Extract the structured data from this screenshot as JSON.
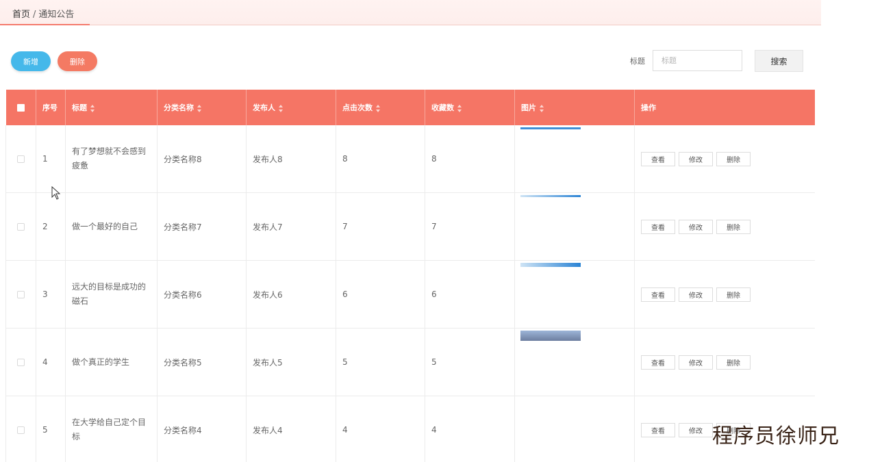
{
  "breadcrumb": {
    "home": "首页",
    "separator": "/",
    "current": "通知公告"
  },
  "toolbar": {
    "add_label": "新增",
    "delete_label": "删除"
  },
  "search": {
    "label": "标题",
    "placeholder": "标题",
    "value": "",
    "button_label": "搜索"
  },
  "table": {
    "columns": [
      "序号",
      "标题",
      "分类名称",
      "发布人",
      "点击次数",
      "收藏数",
      "图片",
      "操作"
    ],
    "rows": [
      {
        "index": "1",
        "title": "有了梦想就不会感到疲惫",
        "category": "分类名称8",
        "publisher": "发布人8",
        "clicks": "8",
        "favorites": "8",
        "image": "sky-banner"
      },
      {
        "index": "2",
        "title": "做一个最好的自己",
        "category": "分类名称7",
        "publisher": "发布人7",
        "clicks": "7",
        "favorites": "7",
        "image": "sky-banner"
      },
      {
        "index": "3",
        "title": "远大的目标是成功的磁石",
        "category": "分类名称6",
        "publisher": "发布人6",
        "clicks": "6",
        "favorites": "6",
        "image": "sky-banner"
      },
      {
        "index": "4",
        "title": "做个真正的学生",
        "category": "分类名称5",
        "publisher": "发布人5",
        "clicks": "5",
        "favorites": "5",
        "image": "mountain-banner"
      },
      {
        "index": "5",
        "title": "在大学给自己定个目标",
        "category": "分类名称4",
        "publisher": "发布人4",
        "clicks": "4",
        "favorites": "4",
        "image": ""
      }
    ],
    "actions": {
      "view": "查看",
      "edit": "修改",
      "delete": "删除"
    }
  },
  "watermark": "程序员徐师兄",
  "colors": {
    "header": "#f57565",
    "add_button": "#45b8ea",
    "delete_button": "#f47a63"
  },
  "icons": {
    "sort": "sort-icon",
    "cursor": "mouse-pointer-icon"
  }
}
